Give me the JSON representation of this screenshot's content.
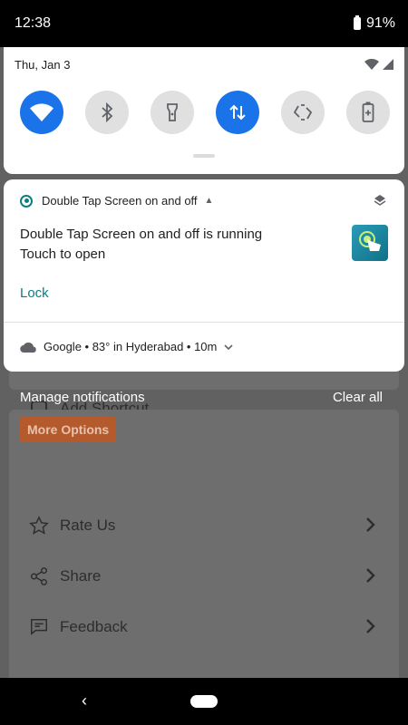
{
  "status_bar": {
    "time": "12:38",
    "battery": "91%"
  },
  "quick_settings": {
    "date": "Thu, Jan 3",
    "tiles": [
      {
        "name": "wifi",
        "on": true
      },
      {
        "name": "bluetooth",
        "on": false
      },
      {
        "name": "flashlight",
        "on": false
      },
      {
        "name": "mobile-data",
        "on": true
      },
      {
        "name": "auto-rotate",
        "on": false
      },
      {
        "name": "battery-saver",
        "on": false
      }
    ]
  },
  "notification": {
    "app_name": "Double Tap Screen on and off",
    "title": "Double Tap Screen on and off is running",
    "text": "Touch to open",
    "action": "Lock"
  },
  "weather": {
    "text": "Google • 83° in Hyderabad • 10m"
  },
  "footer": {
    "manage": "Manage notifications",
    "clear_all": "Clear all"
  },
  "background_app": {
    "add_shortcut": "Add Shortcut",
    "section": "More Options",
    "items": [
      "Rate Us",
      "Share",
      "Feedback"
    ]
  },
  "colors": {
    "accent_blue": "#1a73e8",
    "teal": "#0b7e84",
    "orange": "#b45a2d"
  }
}
